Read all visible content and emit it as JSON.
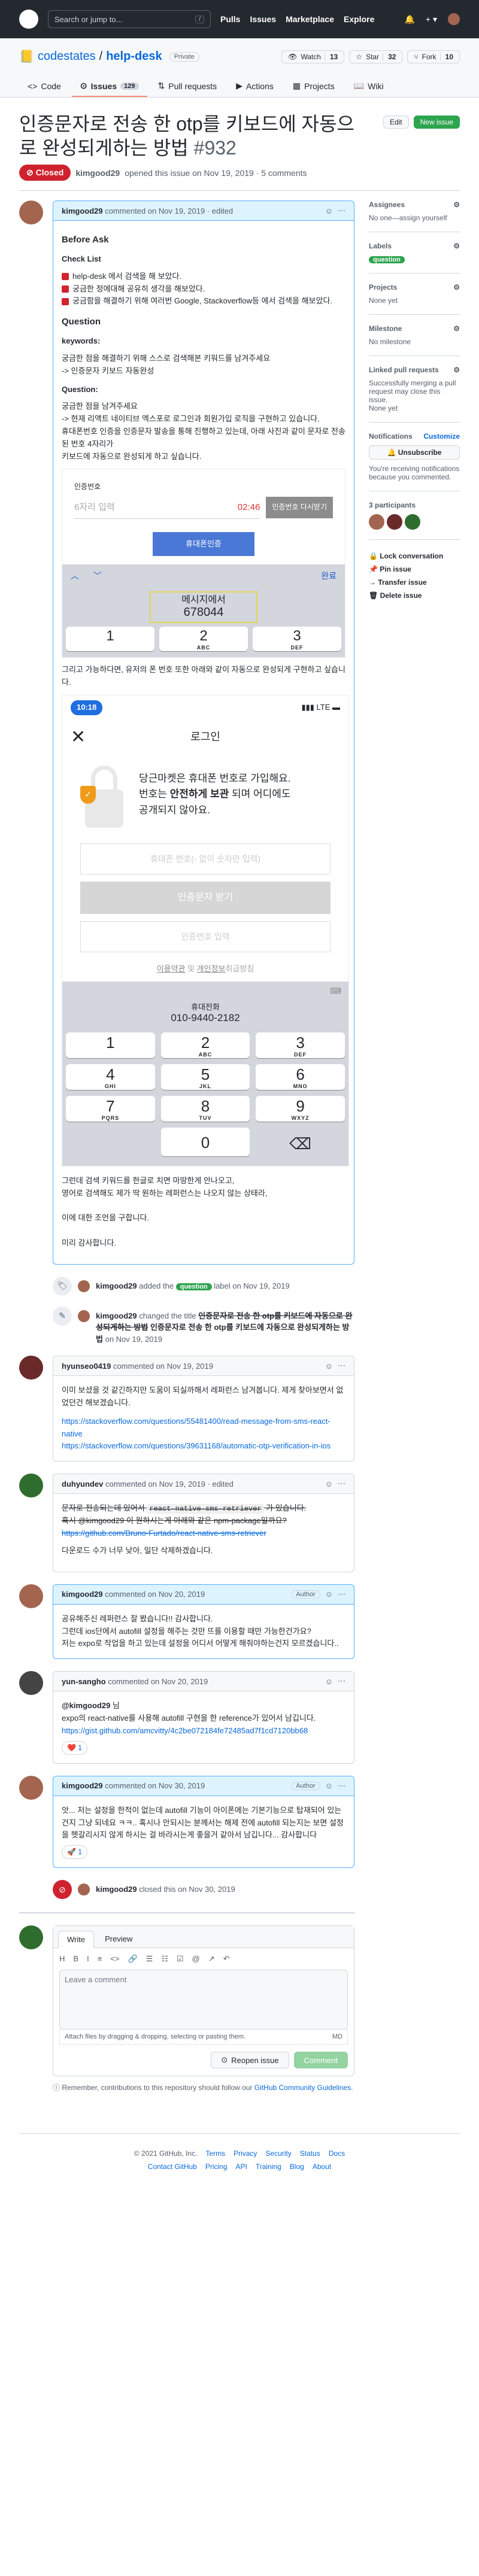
{
  "topnav": {
    "search_placeholder": "Search or jump to...",
    "slash_key": "/",
    "nav": [
      "Pulls",
      "Issues",
      "Marketplace",
      "Explore"
    ],
    "plus": "+ ▾"
  },
  "repo": {
    "owner": "codestates",
    "sep": "/",
    "name": "help-desk",
    "visibility": "Private",
    "watch_label": "Watch",
    "watch_count": "13",
    "star_label": "Star",
    "star_count": "32",
    "fork_label": "Fork",
    "fork_count": "10",
    "tabs": [
      {
        "label": "Code",
        "icon": "<>"
      },
      {
        "label": "Issues",
        "icon": "⊙",
        "count": "129"
      },
      {
        "label": "Pull requests",
        "icon": "⇅"
      },
      {
        "label": "Actions",
        "icon": "▶"
      },
      {
        "label": "Projects",
        "icon": "▦"
      },
      {
        "label": "Wiki",
        "icon": "📖"
      }
    ]
  },
  "issue": {
    "title": "인증문자로 전송 한 otp를 키보드에 자동으로 완성되게하는 방법",
    "number": "#932",
    "edit_label": "Edit",
    "new_issue_label": "New issue",
    "state": "Closed",
    "opener": "kimgood29",
    "meta_text": "opened this issue on Nov 19, 2019 · 5 comments"
  },
  "first_comment": {
    "author": "kimgood29",
    "header_text": "commented on Nov 19, 2019 · edited",
    "heading1": "Before Ask",
    "checklist_title": "Check List",
    "checklist": [
      "help-desk 에서 검색을 해 보았다.",
      "궁금한 정에대해 공유히 생각을 해보았다.",
      "궁금함을 해결하기 위해 여러번 Google, Stackoverflow등 에서 검색을 해보았다."
    ],
    "heading2": "Question",
    "keywords_label": "keywords:",
    "keywords_text": "궁금한 점을 해결하기 위해 스스로 검색해본 키워드를 남겨주세요\n-> 인증문자 키보드 자동완성",
    "question_label": "Question:",
    "question_text": "궁금한 점을 남겨주세요\n-> 현재 리액트 네이티브 엑스포로 로그인과 회원가입 로직을 구현하고 있습니다.\n휴대폰번호 인증을 인증문자 발송을 통해 진행하고 있는데, 아래 사진과 같이 문자로 전송된 번호 4자리가\n키보드에 자동으로 완성되게 하고 싶습니다.",
    "otp_label": "인증번호",
    "otp_placeholder": "6자리 입력",
    "otp_timer": "02:46",
    "resend_label": "인증번호 다시받기",
    "verify_label": "휴대폰인증",
    "done_label": "완료",
    "kb_arrows": "︿ ﹀",
    "sms_line1": "메시지에서",
    "sms_code": "678044",
    "keys": [
      {
        "n": "1",
        "l": ""
      },
      {
        "n": "2",
        "l": "ABC"
      },
      {
        "n": "3",
        "l": "DEF"
      }
    ],
    "para_after": "그리고 가능하다면, 유저의 폰 번호 또한 아래와 같이 자동으로 완성되게 구현하고 싶습니다.",
    "status_time": "10:18",
    "status_right": "▮▮▮ LTE ▬",
    "login_close": "✕",
    "login_title": "로그인",
    "promo_line1": "당근마켓은 휴대폰 번호로 가입해요.",
    "promo_line2a": "번호는 ",
    "promo_line2b": "안전하게 보관",
    "promo_line2c": " 되며 어디에도",
    "promo_line3": "공개되지 않아요.",
    "shield_mark": "✓",
    "phone_placeholder": "휴대폰 번호(- 없이 숫자만 입력)",
    "get_code_label": "인증문자 받기",
    "code_placeholder": "인증번호 입력",
    "terms_a": "이용약관",
    "terms_mid": " 및 ",
    "terms_b": "개인정보",
    "terms_end": "취급방침",
    "phone_sug_label": "휴대전화",
    "phone_sug_number": "010-9440-2182",
    "keys2": [
      {
        "n": "1",
        "l": ""
      },
      {
        "n": "2",
        "l": "ABC"
      },
      {
        "n": "3",
        "l": "DEF"
      },
      {
        "n": "4",
        "l": "GHI"
      },
      {
        "n": "5",
        "l": "JKL"
      },
      {
        "n": "6",
        "l": "MNO"
      },
      {
        "n": "7",
        "l": "PQRS"
      },
      {
        "n": "8",
        "l": "TUV"
      },
      {
        "n": "9",
        "l": "WXYZ"
      },
      {
        "n": "",
        "l": ""
      },
      {
        "n": "0",
        "l": ""
      },
      {
        "n": "⌫",
        "l": ""
      }
    ],
    "outro": "그런데 검색 키워드를 한글로 치면 마땅한게 안나오고,\n영어로 검색해도 제가 딱 원하는 레퍼런스는 나오지 않는 상태라,\n\n이에 대한 조언을 구합니다.\n\n미리 감사합니다."
  },
  "events": {
    "labeled": {
      "actor": "kimgood29",
      "pre": "added the",
      "label": "question",
      "post": "label on Nov 19, 2019"
    },
    "renamed": {
      "actor": "kimgood29",
      "pre": "changed the title",
      "old": "인증문자로 전송 한 otp를 키보드에 자동으로 완성되게하는 방법",
      "new": "인증문자로 전송 한 otp를 키보드에 자동으로 완성되게하는 방법",
      "post": "on Nov 19, 2019"
    },
    "closed": {
      "actor": "kimgood29",
      "text": "closed this on Nov 30, 2019"
    }
  },
  "comments": [
    {
      "author": "hyunseo0419",
      "header": "commented on Nov 19, 2019",
      "lines": [
        "이미 보셨을 것 같긴하지만 도움이 되실까해서 레퍼런스 남겨봅니다. 제게 찾아보면서 없었던건 해보겠습니다."
      ],
      "links": [
        "https://stackoverflow.com/questions/55481400/read-message-from-sms-react-native",
        "https://stackoverflow.com/questions/39631168/automatic-otp-verification-in-ios"
      ]
    },
    {
      "author": "duhyundev",
      "header": "commented on Nov 19, 2019 · edited",
      "pre_code": "문자로 전송되는데 있어서 ",
      "code": "react-native-sms-retriever",
      "post_code": " 가 있습니다.",
      "line2": "혹시 @kimgood29 이 원하시는게 아래와 같은 npm-package일까요?",
      "strike_link": "https://github.com/Bruno-Furtado/react-native-sms-retriever",
      "line3": "다운로드 수가 너무 낮아, 일단 삭제하겠습니다."
    },
    {
      "author": "kimgood29",
      "header": "commented on Nov 20, 2019",
      "role": "Author",
      "lines": [
        "공유해주신 레퍼런스 잘 봤습니다!! 감사합니다.",
        "그런데 ios단에서 autofill 설정을 해주는 것만 뜨를 이용할 때만 가능한건가요?",
        "저는 expo로 작업을 하고 있는데 설정을 어디서 어떻게 해줘야하는건지 모르겠습니다.."
      ]
    },
    {
      "author": "yun-sangho",
      "header": "commented on Nov 20, 2019",
      "mention": "@kimgood29",
      "mention_suffix": " 님",
      "line": "expo의 react-native를 사용해 autofill 구현을 한 reference가 있어서 남깁니다.",
      "link": "https://gist.github.com/amcvitty/4c2be072184fe72485ad7f1cd7120bb68",
      "reaction": "❤️ 1"
    },
    {
      "author": "kimgood29",
      "header": "commented on Nov 30, 2019",
      "role": "Author",
      "lines": [
        "앗... 저는 설정을 한적이 없는데 autofill 기능이 아이폰에는 기본기능으로 탑재되어 있는건지 그냥 되네요 ㅋㅋ.. 혹시나 안되시는 분께서는 해제 전에 autofill 되는지는 보면 설정을 헷갈리시지 않게 하시는 걸 바라시는게 좋을거 같아서 남깁니다... 감사합니다"
      ],
      "reaction": "🚀 1"
    }
  ],
  "sidebar": {
    "assignees_title": "Assignees",
    "assignees_value": "No one—assign yourself",
    "labels_title": "Labels",
    "label": "question",
    "projects_title": "Projects",
    "projects_value": "None yet",
    "milestone_title": "Milestone",
    "milestone_value": "No milestone",
    "linked_title": "Linked pull requests",
    "linked_value": "Successfully merging a pull request may close this issue.",
    "linked_none": "None yet",
    "notif_title": "Notifications",
    "customize": "Customize",
    "unsub": "🔔 Unsubscribe",
    "notif_note": "You're receiving notifications because you commented.",
    "participants": "3 participants",
    "actions": [
      "🔒 Lock conversation",
      "📌 Pin issue",
      "→ Transfer issue",
      "🗑 Delete issue"
    ],
    "gear": "⚙"
  },
  "newcomment": {
    "tab_write": "Write",
    "tab_preview": "Preview",
    "toolbar": [
      "H",
      "B",
      "I",
      "≡",
      "<>",
      "🔗",
      "☰",
      "☷",
      "☑",
      "@",
      "↗",
      "↶"
    ],
    "placeholder": "Leave a comment",
    "attach": "Attach files by dragging & dropping, selecting or pasting them.",
    "md": "MD",
    "reopen": "Reopen issue",
    "comment": "Comment",
    "tip_pre": "ⓘ Remember, contributions to this repository should follow our ",
    "tip_link": "GitHub Community Guidelines",
    "tip_post": "."
  },
  "footer": {
    "row1": [
      "© 2021 GitHub, Inc.",
      "Terms",
      "Privacy",
      "Security",
      "Status",
      "Docs"
    ],
    "row2": [
      "Contact GitHub",
      "Pricing",
      "API",
      "Training",
      "Blog",
      "About"
    ]
  },
  "kebab": "⋯",
  "smile": "☺"
}
